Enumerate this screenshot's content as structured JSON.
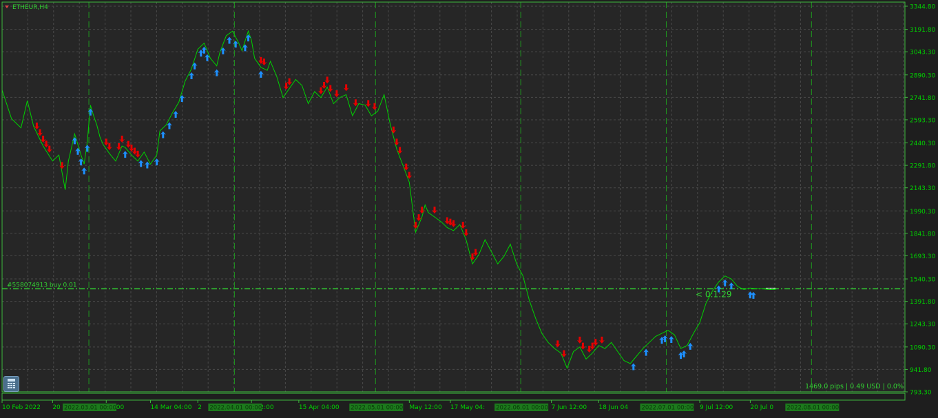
{
  "chart_data": {
    "type": "line",
    "symbol": "ETHEUR,H4",
    "price_levels": [
      "3344.80",
      "3191.80",
      "3043.30",
      "2890.30",
      "2741.80",
      "2593.30",
      "2440.30",
      "2291.80",
      "2143.30",
      "1990.30",
      "1841.80",
      "1693.30",
      "1540.30",
      "1391.80",
      "1243.30",
      "1090.30",
      "941.80",
      "793.30"
    ],
    "ylim": [
      793.3,
      3344.8
    ],
    "time_labels": [
      {
        "t": 0,
        "label": "10 Feb 2022"
      },
      {
        "t": 16,
        "label": "20"
      },
      {
        "t": 33,
        "label": "12:00"
      },
      {
        "t": 47,
        "label": "14 Mar 04:00"
      },
      {
        "t": 62,
        "label": "2"
      },
      {
        "t": 79,
        "label": "r 12:00"
      },
      {
        "t": 94,
        "label": "15 Apr 04:00"
      },
      {
        "t": 129,
        "label": "May 12:00"
      },
      {
        "t": 142,
        "label": "17 May 04:"
      },
      {
        "t": 174,
        "label": "7 Jun 12:00"
      },
      {
        "t": 189,
        "label": "18 Jun 04"
      },
      {
        "t": 221,
        "label": "9 Jul 12:00"
      },
      {
        "t": 237,
        "label": "20 Jul 0"
      }
    ],
    "period_separators": [
      {
        "t": 27.5,
        "label": "2022.03.01 00:00"
      },
      {
        "t": 73.6,
        "label": "2022.04.01 00:00"
      },
      {
        "t": 118.3,
        "label": "2022.05.01 00:00"
      },
      {
        "t": 164.3,
        "label": "2022.06.01 00:00"
      },
      {
        "t": 210.4,
        "label": "2022.07.01 00:00"
      },
      {
        "t": 256.4,
        "label": "2022.08.01 00:00"
      }
    ],
    "price_series": {
      "name": "ETHEUR",
      "x": [
        0,
        3,
        6,
        8,
        10,
        13,
        16,
        18,
        20,
        21,
        23,
        25,
        26,
        27,
        28,
        29,
        30,
        31,
        32,
        34,
        36,
        38,
        39,
        41,
        43,
        45,
        47,
        49,
        50,
        52,
        54,
        56,
        58,
        60,
        62,
        64,
        66,
        68,
        69,
        71,
        73,
        75,
        76,
        78,
        79,
        80,
        82,
        84,
        85,
        87,
        89,
        91,
        93,
        95,
        97,
        99,
        101,
        103,
        105,
        107,
        109,
        111,
        113,
        115,
        117,
        119,
        121,
        123,
        125,
        127,
        129,
        131,
        133,
        134,
        135,
        137,
        139,
        141,
        143,
        145,
        147,
        149,
        151,
        153,
        155,
        157,
        159,
        161,
        163,
        165,
        167,
        169,
        171,
        173,
        175,
        177,
        179,
        181,
        183,
        185,
        187,
        189,
        191,
        193,
        195,
        197,
        199,
        201,
        203,
        205,
        207,
        209,
        211,
        213,
        215,
        217,
        219,
        221,
        223,
        225,
        227,
        229,
        231,
        233,
        235,
        237,
        239,
        241,
        243,
        245
      ],
      "y": [
        2790,
        2600,
        2540,
        2720,
        2550,
        2420,
        2320,
        2360,
        2130,
        2320,
        2500,
        2360,
        2300,
        2450,
        2690,
        2620,
        2560,
        2480,
        2430,
        2370,
        2320,
        2420,
        2410,
        2360,
        2320,
        2380,
        2300,
        2360,
        2520,
        2560,
        2640,
        2710,
        2850,
        2930,
        3060,
        3100,
        3000,
        2950,
        3040,
        3150,
        3180,
        3100,
        3050,
        3180,
        3120,
        3000,
        2940,
        2920,
        2980,
        2880,
        2740,
        2800,
        2860,
        2820,
        2700,
        2780,
        2740,
        2810,
        2700,
        2740,
        2760,
        2620,
        2700,
        2690,
        2620,
        2650,
        2760,
        2560,
        2400,
        2290,
        2180,
        1850,
        1950,
        2030,
        1980,
        1950,
        1920,
        1880,
        1860,
        1900,
        1800,
        1640,
        1700,
        1800,
        1720,
        1640,
        1690,
        1770,
        1640,
        1560,
        1400,
        1280,
        1180,
        1120,
        1080,
        1050,
        950,
        1060,
        1090,
        1010,
        1050,
        1100,
        1080,
        1120,
        1060,
        1000,
        980,
        1030,
        1080,
        1120,
        1160,
        1180,
        1200,
        1170,
        1080,
        1100,
        1180,
        1250,
        1380,
        1460,
        1520,
        1560,
        1540,
        1490,
        1470,
        1480,
        1475,
        1475,
        1470,
        1470
      ]
    },
    "buy_arrow_x": [
      23,
      24,
      25,
      26,
      27,
      28,
      39,
      44,
      46,
      49,
      51,
      53,
      55,
      57,
      60,
      61,
      63,
      64,
      65,
      68,
      70,
      72,
      74,
      77,
      78,
      82,
      200,
      204,
      209,
      210,
      212,
      215,
      216,
      218,
      227,
      229,
      231,
      237,
      238
    ],
    "sell_arrow_x": [
      11,
      12,
      13,
      14,
      15,
      19,
      33,
      34,
      37,
      38,
      40,
      41,
      42,
      43,
      82,
      83,
      90,
      91,
      101,
      102,
      103,
      104,
      106,
      109,
      112,
      116,
      118,
      124,
      125,
      126,
      128,
      129,
      131,
      132,
      133,
      137,
      141,
      142,
      143,
      146,
      147,
      149,
      150,
      176,
      178,
      183,
      184,
      186,
      187,
      188,
      190
    ],
    "trade_line": {
      "label": "#558074913 buy 0.01",
      "price": 1475
    },
    "timer": "< 0:1:29",
    "status": "1469.0 pips | 0.49 USD | 0.0%",
    "colors": {
      "background": "#262626",
      "frame": "#3dbb3d",
      "grid": "#4a4a4a",
      "price_line": "#00d200",
      "axis_text": "#00d200",
      "trade_line": "#32d232",
      "buy_arrow": "#1e90ff",
      "sell_arrow": "#e60000",
      "separator_label_bg": "#1c7a1c"
    },
    "icons": {
      "symbol_marker": "triangle-down-icon",
      "calculator": "calculator-icon"
    }
  }
}
